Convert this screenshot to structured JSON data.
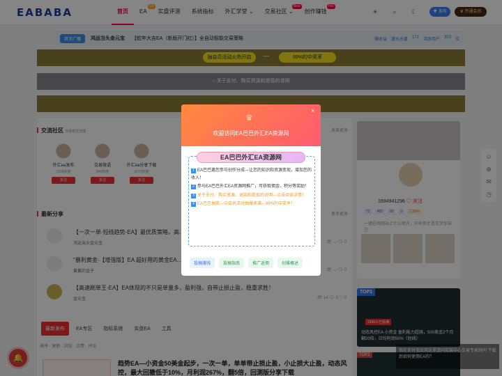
{
  "header": {
    "logo": "EABABA",
    "nav": [
      {
        "label": "首页",
        "active": true,
        "badge": ""
      },
      {
        "label": "EA",
        "active": false,
        "badge": "hot"
      },
      {
        "label": "实盘评测",
        "active": false,
        "badge": ""
      },
      {
        "label": "系统指标",
        "active": false,
        "badge": ""
      },
      {
        "label": "外汇学堂",
        "active": false,
        "badge": ""
      },
      {
        "label": "交易社区",
        "active": false,
        "badge": "New"
      },
      {
        "label": "创作赚钱",
        "active": false,
        "badge": "Hot"
      }
    ],
    "publish_label": "发布",
    "vip_label": "开通会员",
    "icons": [
      "bulb-icon",
      "search-icon",
      "moon-icon"
    ]
  },
  "notice": {
    "tag": "首页广播",
    "title": "鸿运当头金元宝",
    "text": "【蛇年大吉EA（新版开门红）】全自动智能交易策略",
    "right": [
      "赚收益",
      "灌水总量",
      "171",
      "活跃用户",
      "353",
      "位"
    ]
  },
  "band1": {
    "left": "抽会员活动火热开启",
    "dash": "—",
    "right": "99%的中奖率"
  },
  "band2": {
    "text": "关于支付、购买资源和提现的说明"
  },
  "community": {
    "title": "交流社区",
    "subtitle": "交易者交流圈",
    "more": "发表更多",
    "items": [
      {
        "name": "外汇ea发布",
        "count": "1539热度",
        "follow": "关注"
      },
      {
        "name": "交易微语",
        "count": "940热度",
        "follow": "关注"
      },
      {
        "name": "外汇ea分享下载",
        "count": "1073热度",
        "follow": "关注"
      }
    ]
  },
  "share": {
    "title": "最新分享",
    "more": "更多更多",
    "items": [
      {
        "title": "【一次一单-短线趋势-EA】最优质策略，高...",
        "author": "鸿运当头金元宝",
        "meta": "👁 ... 🗨 0"
      },
      {
        "title": "\"暴利黄金-【增强版】EA 超好用的黄金EA...",
        "author": "黄黄的金子",
        "meta": "👁 ... 🗨 0"
      },
      {
        "title": "【高速刷单王-EA】EA体现的不只是单量多，盈利强，自带止损止盈，稳重求胜！",
        "author": "金元宝",
        "meta": "👁 14  🗨 0  ♡ 0"
      }
    ]
  },
  "tabs": [
    "最新发布",
    "EA专区",
    "指标系统",
    "实盘EA",
    "工具"
  ],
  "sort": "排序 · 更新 · 浏览 · 点赞 · 评论",
  "post": {
    "title": "趋势EA—小资金50美金起步，一次一单，单单带止损止盈，小止损大止盈，动态风控，最大回撤低于10%，月利润267%，翻5倍，回测版分享下载"
  },
  "profile": {
    "name": "1694941296",
    "stats": [
      "72",
      "463",
      "90",
      "0",
      "7.3W+"
    ],
    "follow": "关注",
    "desc": "一键在线网站上什么地方，只有你才是交叉你自己"
  },
  "top1": {
    "tag": "TOP1",
    "badge": "1896人已看满",
    "caption": "动态风控EA 小资金 盈利能力超强，500美金2个月翻20倍，日均利润50%（短线）"
  },
  "top2": {
    "tag": "TOP2"
  },
  "toast": "我在支付宝应用这里请问安装中心交易专家顾问 下载后如何使用EA的？",
  "modal": {
    "header": "欢迎访问EA巴巴外汇EA资源网",
    "banner": "EA巴巴外汇EA资源网",
    "close": "×",
    "items": [
      {
        "n": "1",
        "text": "EA巴巴邀您参与创作分成---让您的知识和资源变现，增加您的收入！",
        "color": "#333"
      },
      {
        "n": "2",
        "text": "参与EA巴巴外汇EA资源网推广，可获取佣金、积分等奖励！",
        "color": "#333"
      },
      {
        "n": "3",
        "text": "关于支付、购买资源、退款和提现的说明---点击阅读详情！",
        "color": "#f29a1b"
      },
      {
        "n": "4",
        "text": "EA巴巴抽奖---中会员活动抽爆来袭---99%的中奖率！",
        "color": "#f29a1b"
      }
    ],
    "buttons": [
      {
        "label": "投稿赚钱",
        "bg": "#e8f1ff",
        "color": "#3a7bf6"
      },
      {
        "label": "投稿指南",
        "bg": "#e9f8ee",
        "color": "#2aa05a"
      },
      {
        "label": "推广返佣",
        "bg": "#e9f8ee",
        "color": "#2aa05a"
      },
      {
        "label": "创雅概述",
        "bg": "#e9f8ee",
        "color": "#2aa05a"
      }
    ]
  }
}
